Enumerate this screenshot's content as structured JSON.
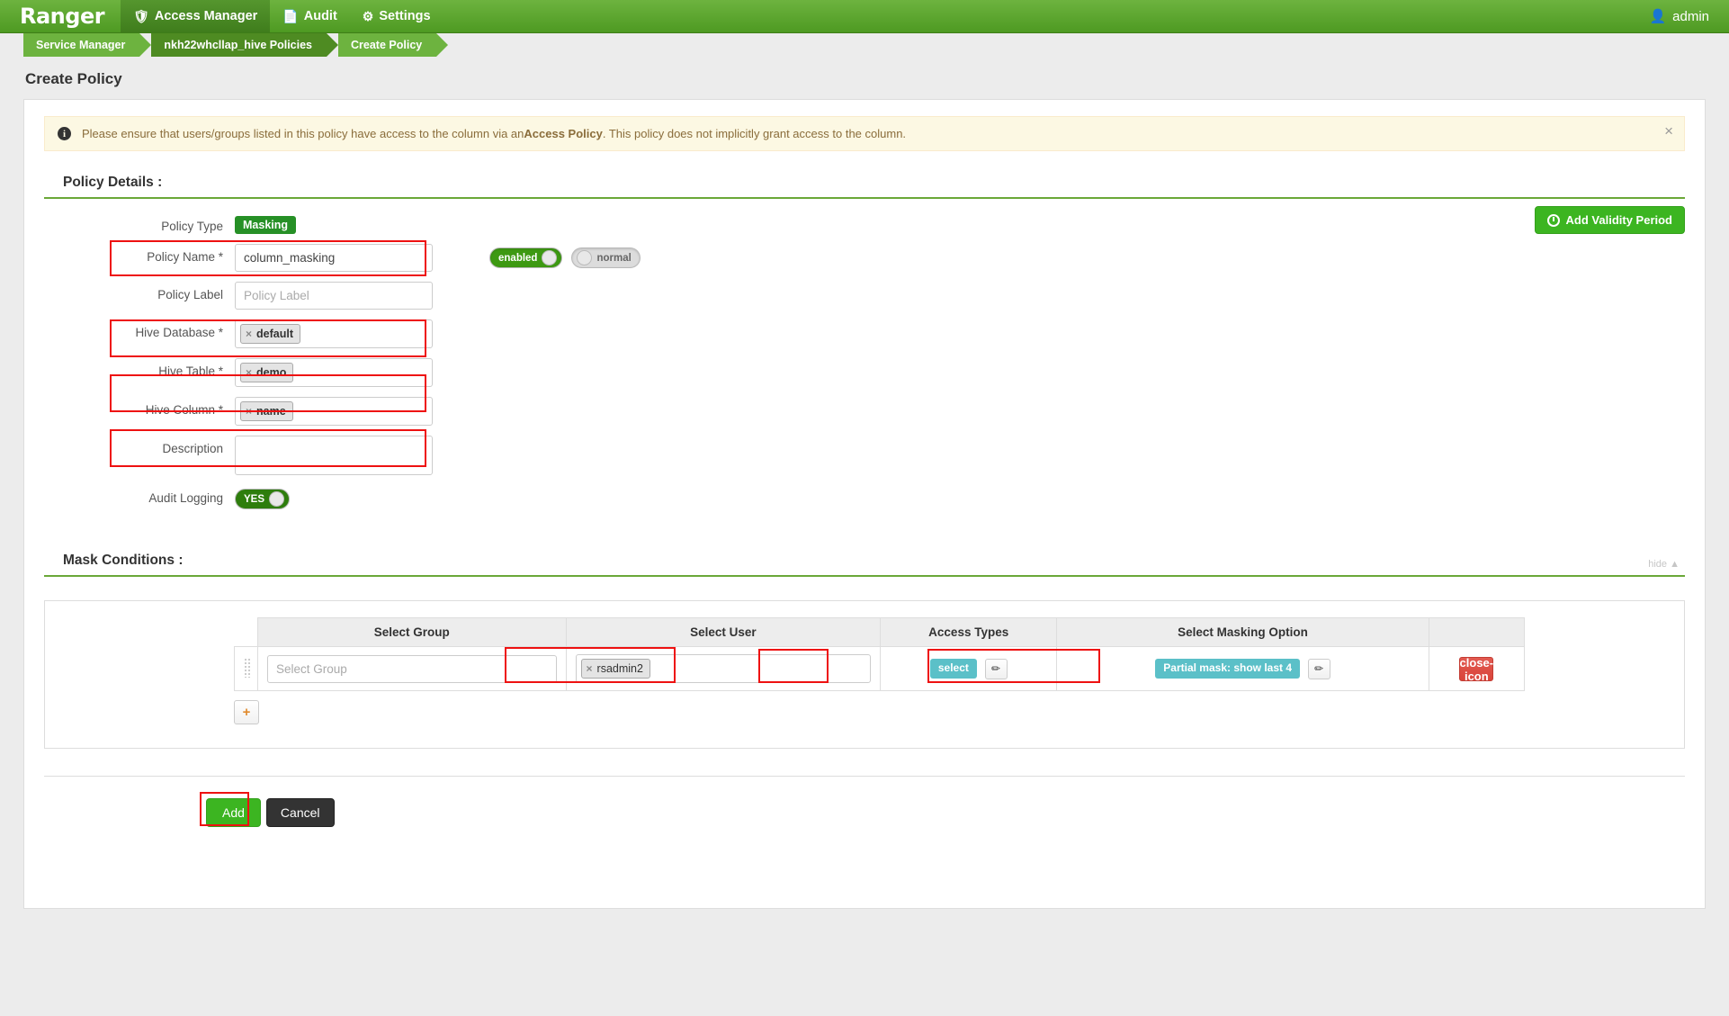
{
  "nav": {
    "brand": "Ranger",
    "items": [
      {
        "label": "Access Manager",
        "icon": "shield-icon",
        "active": true
      },
      {
        "label": "Audit",
        "icon": "file-icon",
        "active": false
      },
      {
        "label": "Settings",
        "icon": "gear-icon",
        "active": false
      }
    ],
    "user": "admin",
    "user_icon": "user-icon"
  },
  "breadcrumb": {
    "items": [
      "Service Manager",
      "nkh22whcllap_hive Policies",
      "Create Policy"
    ]
  },
  "page": {
    "title": "Create Policy"
  },
  "alert": {
    "icon": "info-icon",
    "text_before": "Please ensure that users/groups listed in this policy have access to the column via an ",
    "bold": "Access Policy",
    "text_after": ". This policy does not implicitly grant access to the column.",
    "close": "×"
  },
  "policy_details": {
    "heading": "Policy Details :",
    "validity_button": {
      "label": "Add Validity Period",
      "icon": "clock-icon"
    },
    "policy_type": {
      "label": "Policy Type",
      "value": "Masking"
    },
    "policy_name": {
      "label": "Policy Name *",
      "value": "column_masking"
    },
    "status_toggle": {
      "label": "enabled"
    },
    "normal_toggle": {
      "label": "normal"
    },
    "policy_label": {
      "label": "Policy Label",
      "placeholder": "Policy Label",
      "value": ""
    },
    "hive_database": {
      "label": "Hive Database *",
      "token": "default",
      "remove": "×"
    },
    "hive_table": {
      "label": "Hive Table *",
      "token": "demo",
      "remove": "×"
    },
    "hive_column": {
      "label": "Hive Column *",
      "token": "name",
      "remove": "×"
    },
    "description": {
      "label": "Description",
      "value": ""
    },
    "audit_logging": {
      "label": "Audit Logging",
      "value": "YES"
    }
  },
  "mask_conditions": {
    "heading": "Mask Conditions :",
    "hide_link": "hide",
    "columns": [
      "Select Group",
      "Select User",
      "Access Types",
      "Select Masking Option",
      ""
    ],
    "rows": [
      {
        "group_placeholder": "Select Group",
        "group_value": "",
        "user_token": "rsadmin2",
        "user_remove": "×",
        "access_type": "select",
        "masking_option": "Partial mask: show last 4",
        "edit_icon": "pencil-icon",
        "delete_icon": "close-icon"
      }
    ],
    "add_row_button": "+"
  },
  "footer": {
    "add_label": "Add",
    "cancel_label": "Cancel"
  },
  "colors": {
    "brand_green": "#6db33f",
    "accent_green": "#3cb521",
    "chip_teal": "#5bc0c8",
    "highlight_red": "#ee1111",
    "alert_bg": "#fcf8e3"
  }
}
